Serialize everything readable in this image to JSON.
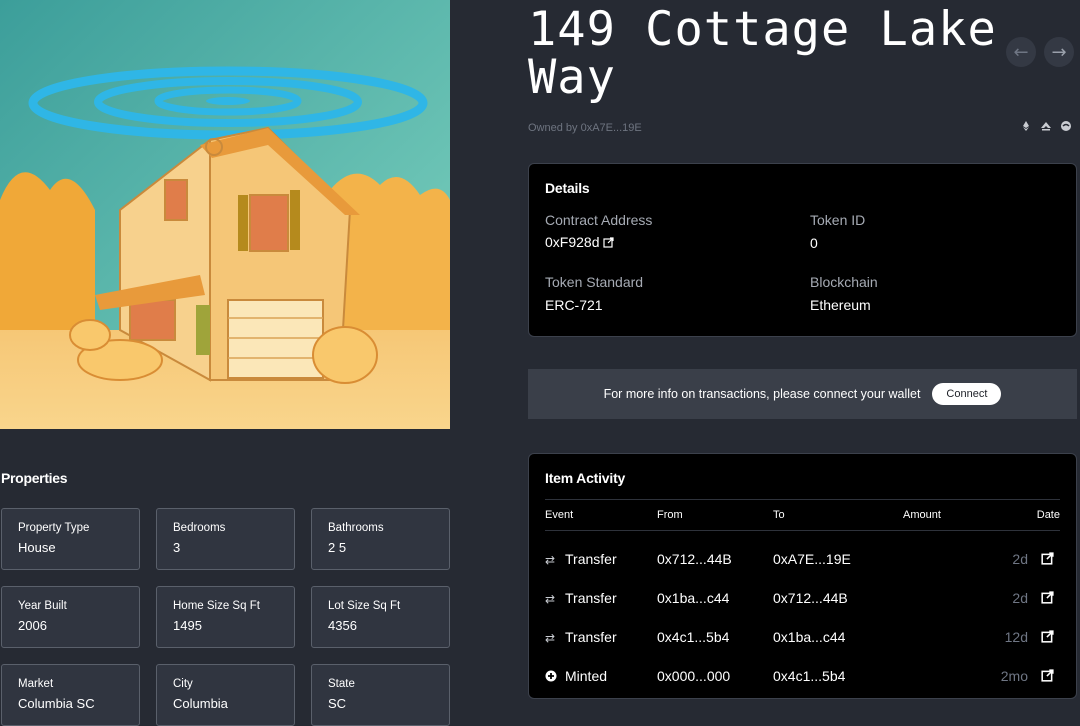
{
  "title": "149 Cottage Lake Way",
  "owner_text": "Owned by 0xA7E...19E",
  "nav": {
    "prev_icon": "arrow-left-icon",
    "next_icon": "arrow-right-icon"
  },
  "share_icons": [
    "ethereum-icon",
    "opensea-icon",
    "globe-icon"
  ],
  "details": {
    "heading": "Details",
    "contract_address_label": "Contract Address",
    "contract_address_value": "0xF928d",
    "token_id_label": "Token ID",
    "token_id_value": "0",
    "token_standard_label": "Token Standard",
    "token_standard_value": "ERC-721",
    "blockchain_label": "Blockchain",
    "blockchain_value": "Ethereum"
  },
  "banner": {
    "text": "For more info on transactions, please connect your wallet",
    "button": "Connect"
  },
  "activity": {
    "heading": "Item Activity",
    "columns": {
      "event": "Event",
      "from": "From",
      "to": "To",
      "amount": "Amount",
      "date": "Date"
    },
    "rows": [
      {
        "icon": "transfer-icon",
        "event": "Transfer",
        "from": "0x712...44B",
        "to": "0xA7E...19E",
        "amount": "",
        "date": "2d"
      },
      {
        "icon": "transfer-icon",
        "event": "Transfer",
        "from": "0x1ba...c44",
        "to": "0x712...44B",
        "amount": "",
        "date": "2d"
      },
      {
        "icon": "transfer-icon",
        "event": "Transfer",
        "from": "0x4c1...5b4",
        "to": "0x1ba...c44",
        "amount": "",
        "date": "12d"
      },
      {
        "icon": "minted-icon",
        "event": "Minted",
        "from": "0x000...000",
        "to": "0x4c1...5b4",
        "amount": "",
        "date": "2mo"
      }
    ]
  },
  "properties": {
    "heading": "Properties",
    "items": [
      {
        "label": "Property Type",
        "value": "House"
      },
      {
        "label": "Bedrooms",
        "value": "3"
      },
      {
        "label": "Bathrooms",
        "value": "2 5"
      },
      {
        "label": "Year Built",
        "value": "2006"
      },
      {
        "label": "Home Size Sq Ft",
        "value": "1495"
      },
      {
        "label": "Lot Size Sq Ft",
        "value": "4356"
      },
      {
        "label": "Market",
        "value": "Columbia SC"
      },
      {
        "label": "City",
        "value": "Columbia"
      },
      {
        "label": "State",
        "value": "SC"
      }
    ]
  },
  "colors": {
    "background": "#262a33",
    "card": "#000000",
    "date_muted": "#6f7684"
  }
}
